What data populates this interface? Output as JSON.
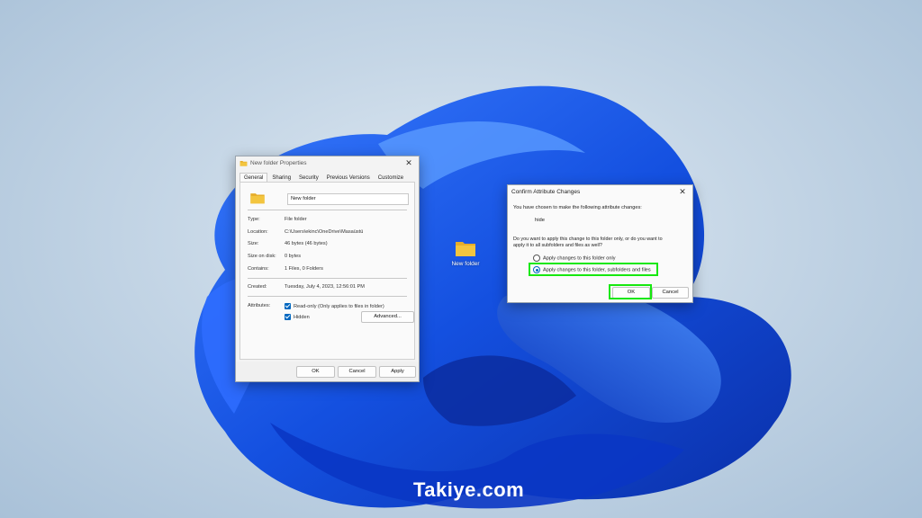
{
  "desktop": {
    "icon_label": "New folder",
    "watermark": "Takiye.com"
  },
  "properties": {
    "title": "New folder Properties",
    "tabs": [
      "General",
      "Sharing",
      "Security",
      "Previous Versions",
      "Customize"
    ],
    "name_value": "New folder",
    "fields": [
      {
        "label": "Type:",
        "value": "File folder"
      },
      {
        "label": "Location:",
        "value": "C:\\Users\\ekinc\\OneDrive\\Masaüstü"
      },
      {
        "label": "Size:",
        "value": "46 bytes (46 bytes)"
      },
      {
        "label": "Size on disk:",
        "value": "0 bytes"
      },
      {
        "label": "Contains:",
        "value": "1 Files, 0 Folders"
      },
      {
        "label": "Created:",
        "value": "Tuesday, July 4, 2023, 12:56:01 PM"
      }
    ],
    "attributes_label": "Attributes:",
    "readonly_label": "Read-only (Only applies to files in folder)",
    "hidden_label": "Hidden",
    "advanced_button": "Advanced...",
    "ok_button": "OK",
    "cancel_button": "Cancel",
    "apply_button": "Apply"
  },
  "confirm": {
    "title": "Confirm Attribute Changes",
    "intro": "You have chosen to make the following attribute changes:",
    "change": "hide",
    "question_line1": "Do you want to apply this change to this folder only, or do you want to",
    "question_line2": "apply it to all subfolders and files as well?",
    "option1": "Apply changes to this folder only",
    "option2": "Apply changes to this folder, subfolders and files",
    "selected_option": 2,
    "ok_button": "OK",
    "cancel_button": "Cancel"
  },
  "colors": {
    "accent": "#0067c0",
    "highlight": "#17e80f",
    "folder": "#f3c53f"
  }
}
